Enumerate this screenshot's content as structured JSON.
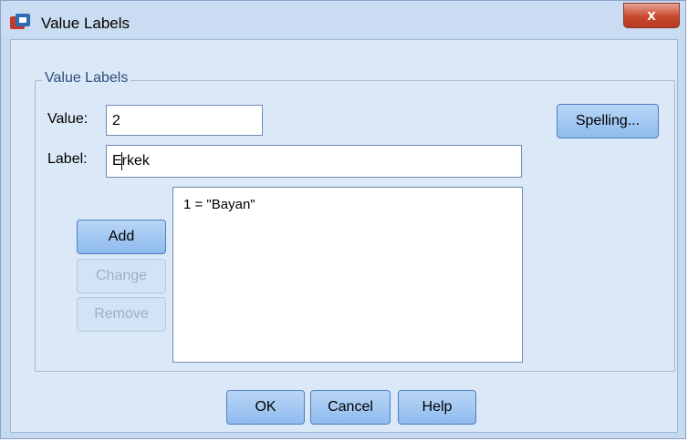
{
  "window": {
    "title": "Value Labels",
    "close_label": "x",
    "icon": "spss-value-labels-icon"
  },
  "group": {
    "legend": "Value Labels"
  },
  "value_field": {
    "label": "Value:",
    "value": "2"
  },
  "label_field": {
    "label": "Label:",
    "value": "Erkek"
  },
  "list": {
    "items": [
      "1 = \"Bayan\""
    ]
  },
  "buttons": {
    "spelling": "Spelling...",
    "add": "Add",
    "change": "Change",
    "remove": "Remove",
    "ok": "OK",
    "cancel": "Cancel",
    "help": "Help"
  }
}
